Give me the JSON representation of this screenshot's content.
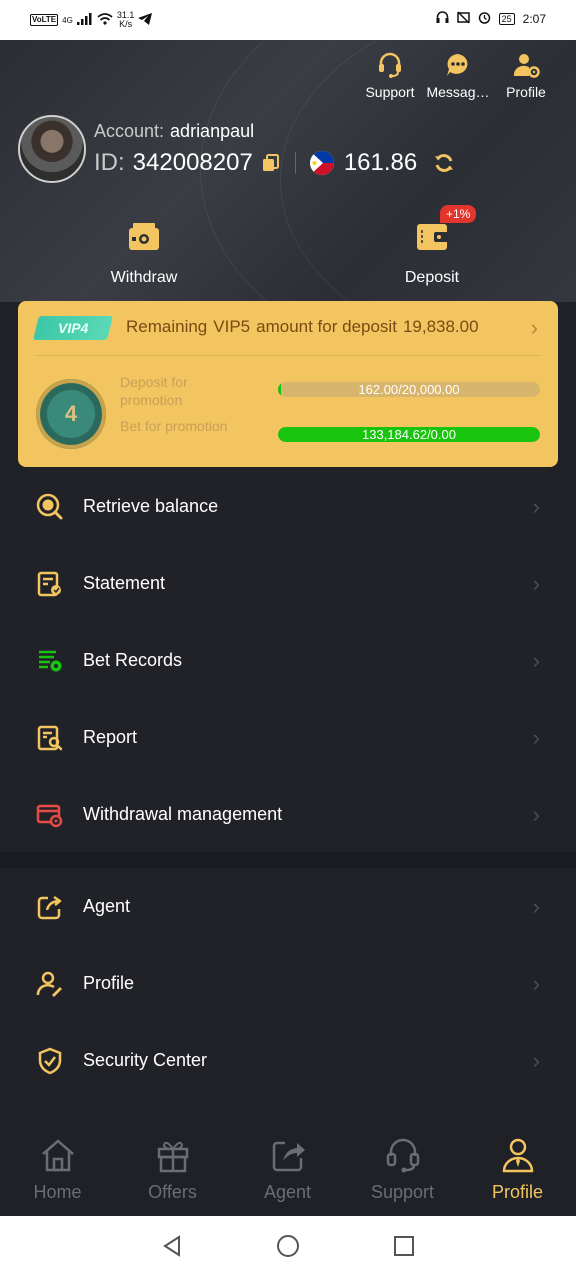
{
  "status_bar": {
    "volte": "VoLTE",
    "signal_label": "4G",
    "net_speed_value": "31.1",
    "net_speed_unit": "K/s",
    "battery": "25",
    "time": "2:07"
  },
  "top_nav": [
    {
      "label": "Support",
      "icon": "headset-icon"
    },
    {
      "label": "Messag…",
      "icon": "chat-icon"
    },
    {
      "label": "Profile",
      "icon": "user-gear-icon"
    }
  ],
  "account": {
    "account_label": "Account:",
    "username": "adrianpaul",
    "id_label": "ID:",
    "id_value": "342008207",
    "balance": "161.86"
  },
  "quick_actions": {
    "withdraw_label": "Withdraw",
    "deposit_label": "Deposit",
    "deposit_badge": "+1%"
  },
  "vip": {
    "level_badge": "VIP4",
    "remain_a": "Remaining",
    "remain_b": "VIP5",
    "remain_c": "amount for deposit",
    "remain_amount": "19,838.00",
    "medal_level": "4",
    "deposit_label": "Deposit for promotion",
    "deposit_progress_text": "162.00/20,000.00",
    "deposit_progress_fraction": 0.008,
    "bet_label": "Bet for promotion",
    "bet_progress_text": "133,184.62/0.00",
    "bet_progress_fraction": 1.0
  },
  "menu_primary": [
    {
      "label": "Retrieve balance",
      "icon": "coin-search-icon"
    },
    {
      "label": "Statement",
      "icon": "statement-icon"
    },
    {
      "label": "Bet Records",
      "icon": "bet-records-icon"
    },
    {
      "label": "Report",
      "icon": "report-search-icon"
    },
    {
      "label": "Withdrawal management",
      "icon": "withdrawal-settings-icon"
    }
  ],
  "menu_secondary": [
    {
      "label": "Agent",
      "icon": "share-icon"
    },
    {
      "label": "Profile",
      "icon": "user-edit-icon"
    },
    {
      "label": "Security Center",
      "icon": "shield-check-icon"
    }
  ],
  "bottom_nav": [
    {
      "label": "Home",
      "icon": "home-icon"
    },
    {
      "label": "Offers",
      "icon": "gift-icon"
    },
    {
      "label": "Agent",
      "icon": "share-icon"
    },
    {
      "label": "Support",
      "icon": "headset-icon"
    },
    {
      "label": "Profile",
      "icon": "user-icon",
      "active": true
    }
  ],
  "colors": {
    "accent": "#f2c560",
    "background": "#1f2126",
    "progress_fill": "#19c40f",
    "badge_red": "#e2352b"
  }
}
